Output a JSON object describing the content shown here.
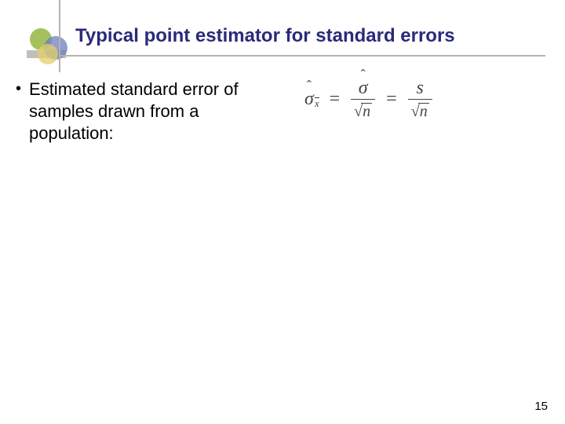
{
  "title": "Typical point estimator for standard errors",
  "bullet": "Estimated standard error of samples drawn from a population:",
  "formula": {
    "lhs_sigma": "σ",
    "lhs_sub_x": "x",
    "eq": "=",
    "mid_num_sigma": "σ",
    "mid_den_n": "n",
    "rhs_num_s": "s",
    "rhs_den_n": "n"
  },
  "page_number": "15"
}
